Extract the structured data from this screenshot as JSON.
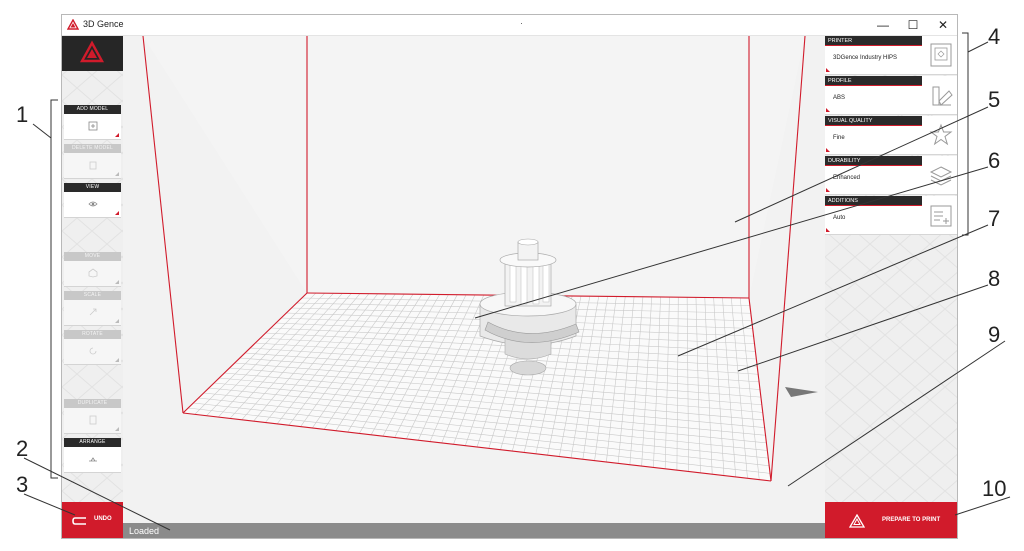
{
  "window": {
    "app_title": "3D Gence",
    "title_dot": "·",
    "minimize_glyph": "—",
    "maximize_glyph": "☐",
    "close_glyph": "✕"
  },
  "left_toolbar": {
    "groups": [
      {
        "label": "ADD MODEL",
        "icon": "add-model-icon",
        "enabled": true
      },
      {
        "label": "DELETE MODEL",
        "icon": "delete-model-icon",
        "enabled": false
      },
      {
        "label": "VIEW",
        "icon": "eye-icon",
        "enabled": true
      },
      {
        "label": "MOVE",
        "icon": "move-icon",
        "enabled": false
      },
      {
        "label": "SCALE",
        "icon": "scale-icon",
        "enabled": false
      },
      {
        "label": "ROTATE",
        "icon": "rotate-icon",
        "enabled": false
      },
      {
        "label": "DUPLICATE",
        "icon": "duplicate-icon",
        "enabled": false
      },
      {
        "label": "ARRANGE",
        "icon": "arrange-icon",
        "enabled": true
      }
    ],
    "undo_label": "UNDO"
  },
  "right_panel": {
    "items": [
      {
        "header": "PRINTER",
        "value": "3DGence Industry HIPS",
        "icon": "printer-icon"
      },
      {
        "header": "PROFILE",
        "value": "ABS",
        "icon": "color-swatch-icon"
      },
      {
        "header": "VISUAL QUALITY",
        "value": "Fine",
        "icon": "star-icon"
      },
      {
        "header": "DURABILITY",
        "value": "Enhanced",
        "icon": "layers-icon"
      },
      {
        "header": "ADDITIONS",
        "value": "Auto",
        "icon": "add-list-icon"
      }
    ],
    "prepare_label": "PREPARE TO PRINT"
  },
  "status": {
    "text": "Loaded"
  },
  "callouts": [
    "1",
    "2",
    "3",
    "4",
    "5",
    "6",
    "7",
    "8",
    "9",
    "10"
  ],
  "colors": {
    "accent": "#d11b2b",
    "dark": "#2a2a2a",
    "status_bar": "#8b8b8b"
  }
}
